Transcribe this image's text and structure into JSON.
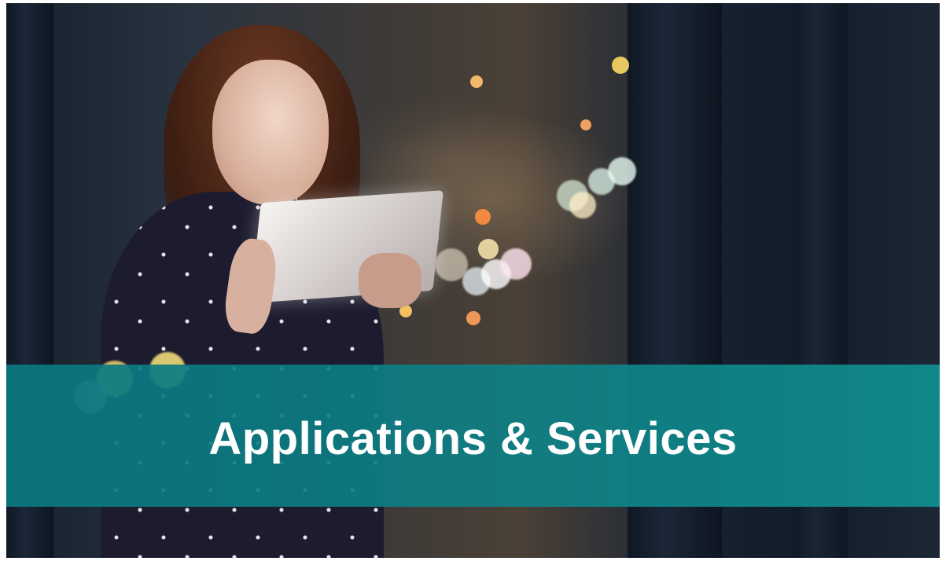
{
  "banner": {
    "title": "Applications & Services",
    "color": "#0e7f86"
  },
  "photo": {
    "subject": "woman using tablet at night by window",
    "accent_colors": [
      "#f3c46b",
      "#e9e4dc",
      "#6e3a22"
    ]
  }
}
